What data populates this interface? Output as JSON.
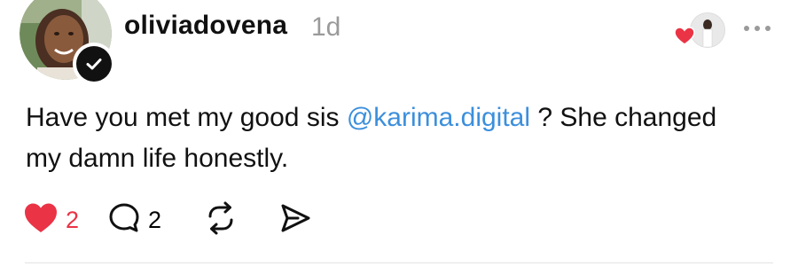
{
  "post": {
    "username": "oliviadovena",
    "timestamp": "1d",
    "text_before_mention": "Have you met my good sis ",
    "mention": "@karima.digital",
    "text_after_mention": " ? She changed my damn life honestly.",
    "likes_count": "2",
    "replies_count": "2",
    "verified": true
  },
  "colors": {
    "like_red": "#ea3345",
    "mention_blue": "#3c8fdc",
    "timestamp_gray": "#9a9a9a"
  },
  "icons": {
    "like": "heart-filled-icon",
    "reply": "speech-bubble-icon",
    "repost": "repost-arrows-icon",
    "share": "send-arrow-icon",
    "more": "ellipsis-icon",
    "verified": "check-badge-icon"
  }
}
